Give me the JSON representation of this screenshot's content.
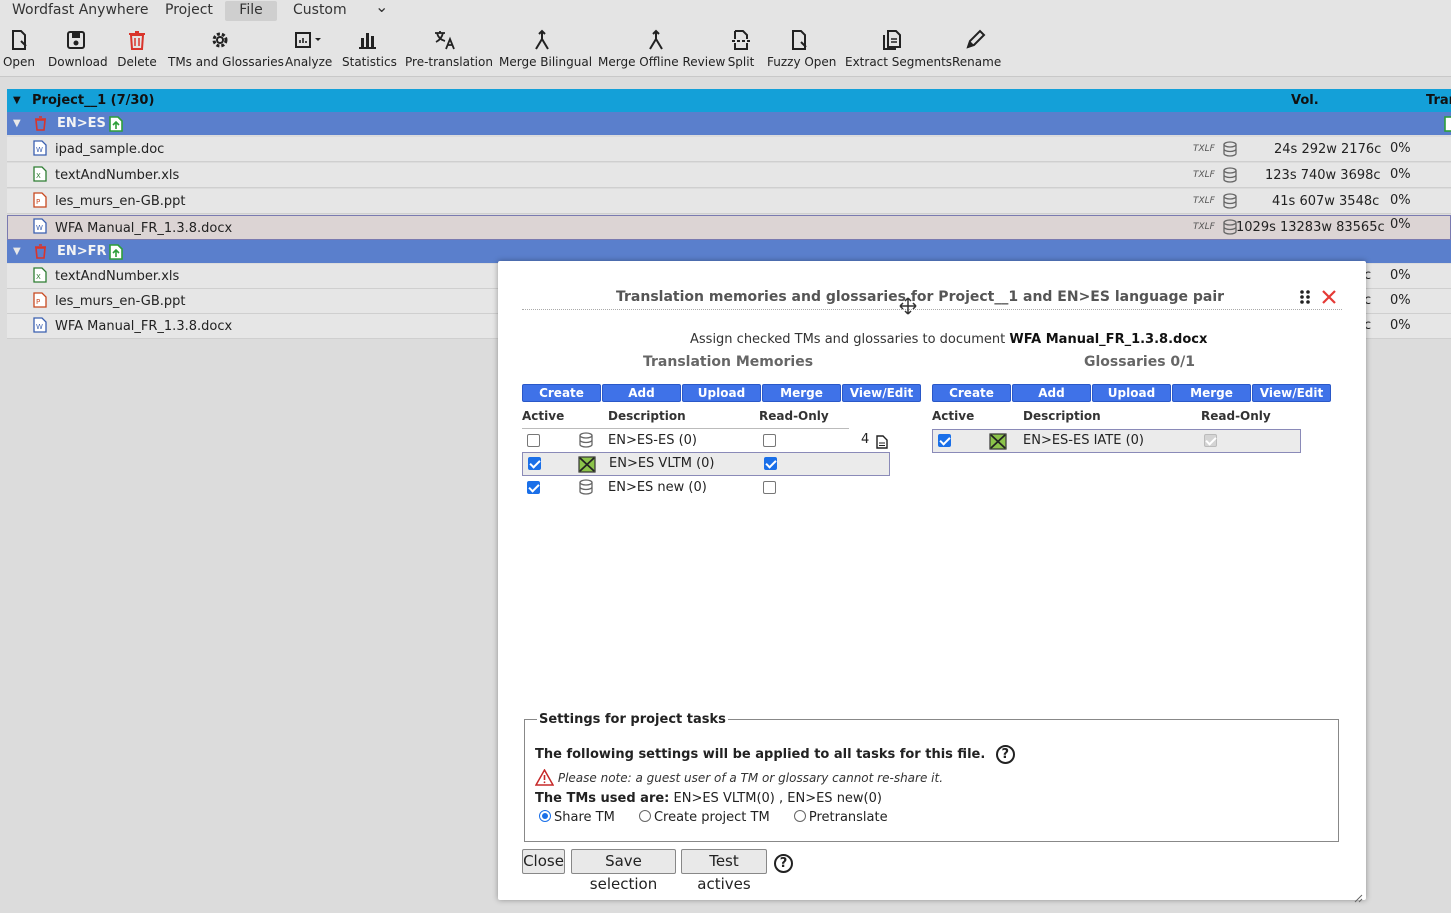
{
  "menu": {
    "app": "Wordfast Anywhere",
    "project": "Project",
    "file": "File",
    "custom": "Custom",
    "more": "⌄"
  },
  "toolbar": {
    "open": "Open",
    "download": "Download",
    "delete": "Delete",
    "tms": "TMs and Glossaries",
    "analyze": "Analyze",
    "statistics": "Statistics",
    "pretranslation": "Pre-translation",
    "merge_bilingual": "Merge Bilingual",
    "merge_offline": "Merge Offline Review",
    "split": "Split",
    "fuzzy_open": "Fuzzy Open",
    "extract": "Extract Segments",
    "rename": "Rename"
  },
  "tree": {
    "project_label": "Project__1 (7/30)",
    "vol_header": "Vol.",
    "tra_header": "Tran",
    "groups": [
      {
        "lang": "EN>ES",
        "files": [
          {
            "name": "ipad_sample.doc",
            "type": "TXLF",
            "vol": "24s 292w 2176c",
            "pct": "0%"
          },
          {
            "name": "textAndNumber.xls",
            "type": "TXLF",
            "vol": "123s 740w 3698c",
            "pct": "0%"
          },
          {
            "name": "les_murs_en-GB.ppt",
            "type": "TXLF",
            "vol": "41s 607w 3548c",
            "pct": "0%"
          },
          {
            "name": "WFA Manual_FR_1.3.8.docx",
            "type": "TXLF",
            "vol": "1029s 13283w 83565c",
            "pct": "0%"
          }
        ]
      },
      {
        "lang": "EN>FR",
        "files": [
          {
            "name": "textAndNumber.xls",
            "vol_tail": "c",
            "pct": "0%"
          },
          {
            "name": "les_murs_en-GB.ppt",
            "vol_tail": "c",
            "pct": "0%"
          },
          {
            "name": "WFA Manual_FR_1.3.8.docx",
            "vol_tail": "c",
            "pct": "0%"
          }
        ]
      }
    ]
  },
  "dialog": {
    "title": "Translation memories and glossaries for Project__1 and EN>ES language pair",
    "assign_prefix": "Assign checked TMs and glossaries to document",
    "assign_doc": "WFA Manual_FR_1.3.8.docx",
    "tm_section": "Translation Memories",
    "gl_section": "Glossaries 0/1",
    "buttons": [
      "Create",
      "Add",
      "Upload",
      "Merge",
      "View/Edit"
    ],
    "col_active": "Active",
    "col_desc": "Description",
    "col_ro": "Read-Only",
    "tm_count": "4",
    "tms": [
      {
        "desc": "EN>ES-ES (0)",
        "active": false,
        "readonly": false,
        "icon": "database-icon"
      },
      {
        "desc": "EN>ES VLTM (0)",
        "active": true,
        "readonly": true,
        "icon": "crossed-tm-icon"
      },
      {
        "desc": "EN>ES new (0)",
        "active": true,
        "readonly": false,
        "icon": "database-icon"
      }
    ],
    "glossaries": [
      {
        "desc": "EN>ES-ES IATE (0)",
        "active": true,
        "readonly": true,
        "icon": "crossed-glossary-icon"
      }
    ],
    "settings": {
      "legend": "Settings for project tasks",
      "line1": "The following settings will be applied to all tasks for this file.",
      "note": "Please note: a guest user of a TM or glossary cannot re-share it.",
      "used_label": "The TMs used are:",
      "used_value": "EN>ES VLTM(0) , EN>ES new(0)",
      "opt_share": "Share TM",
      "opt_create": "Create project TM",
      "opt_pretranslate": "Pretranslate",
      "selected": "share"
    },
    "close_btn": "Close",
    "save_btn": "Save selection",
    "test_btn": "Test actives",
    "help_glyph": "?"
  },
  "colors": {
    "project_row": "#14a0d8",
    "lang_row": "#5a7fcc",
    "dialog_button": "#3f72e8",
    "close_x": "#e53935"
  }
}
